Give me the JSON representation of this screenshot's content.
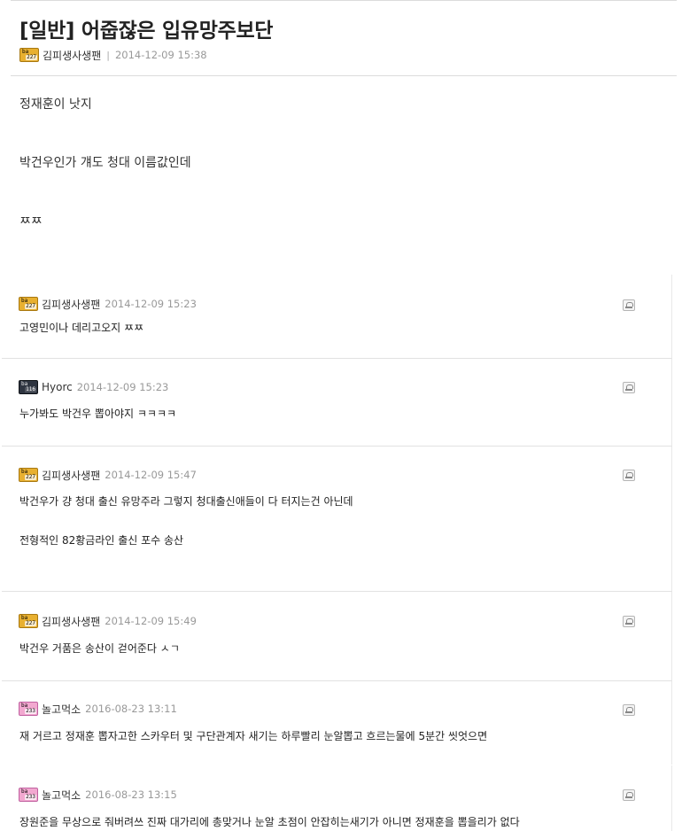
{
  "post": {
    "title": "[일반] 어줍잖은 입유망주보단",
    "author": {
      "nickname": "김피생사생팬",
      "badge_text": "ba",
      "badge_num": "227",
      "badge_color": "#e8b030"
    },
    "date": "2014-12-09 15:38",
    "body_lines": [
      "정재훈이 낫지",
      "박건우인가 걔도 청대 이름값인데",
      "ㅉㅉ"
    ]
  },
  "comments": [
    {
      "nickname": "김피생사생팬",
      "badge": "gold",
      "badge_text": "ba",
      "badge_num": "227",
      "date": "2014-12-09 15:23",
      "lines": [
        "고영민이나 데리고오지 ㅉㅉ"
      ]
    },
    {
      "nickname": "Hyorc",
      "badge": "dark",
      "badge_text": "ba",
      "badge_num": "116",
      "date": "2014-12-09 15:23",
      "lines": [
        "누가봐도 박건우 뽑아야지 ㅋㅋㅋㅋ"
      ]
    },
    {
      "nickname": "김피생사생팬",
      "badge": "gold",
      "badge_text": "ba",
      "badge_num": "227",
      "date": "2014-12-09 15:47",
      "lines": [
        "박건우가 걍 청대 출신 유망주라 그렇지 청대출신애들이 다 터지는건 아닌데",
        "전형적인 82황금라인 출신 포수 송산"
      ]
    },
    {
      "nickname": "김피생사생팬",
      "badge": "gold",
      "badge_text": "ba",
      "badge_num": "227",
      "date": "2014-12-09 15:49",
      "lines": [
        "박건우 거품은 송산이 걷어준다 ㅅㄱ"
      ]
    },
    {
      "nickname": "놀고먹소",
      "badge": "pink",
      "badge_text": "ba",
      "badge_num": "233",
      "date": "2016-08-23 13:11",
      "lines": [
        "재 거르고 정재훈 뽑자고한 스카우터 및 구단관계자 새기는 하루빨리 눈알뽑고 흐르는물에 5분간 씻엇으면"
      ]
    },
    {
      "nickname": "놀고먹소",
      "badge": "pink",
      "badge_text": "ba",
      "badge_num": "233",
      "date": "2016-08-23 13:15",
      "lines": [
        "장원준을 무상으로 줘버려쓰 진짜 대가리에 총맞거나 눈알 초점이 안잡히는새기가 아니면 정재훈을 뽑을리가 없다"
      ]
    }
  ],
  "icons": {
    "report": "report-icon"
  }
}
